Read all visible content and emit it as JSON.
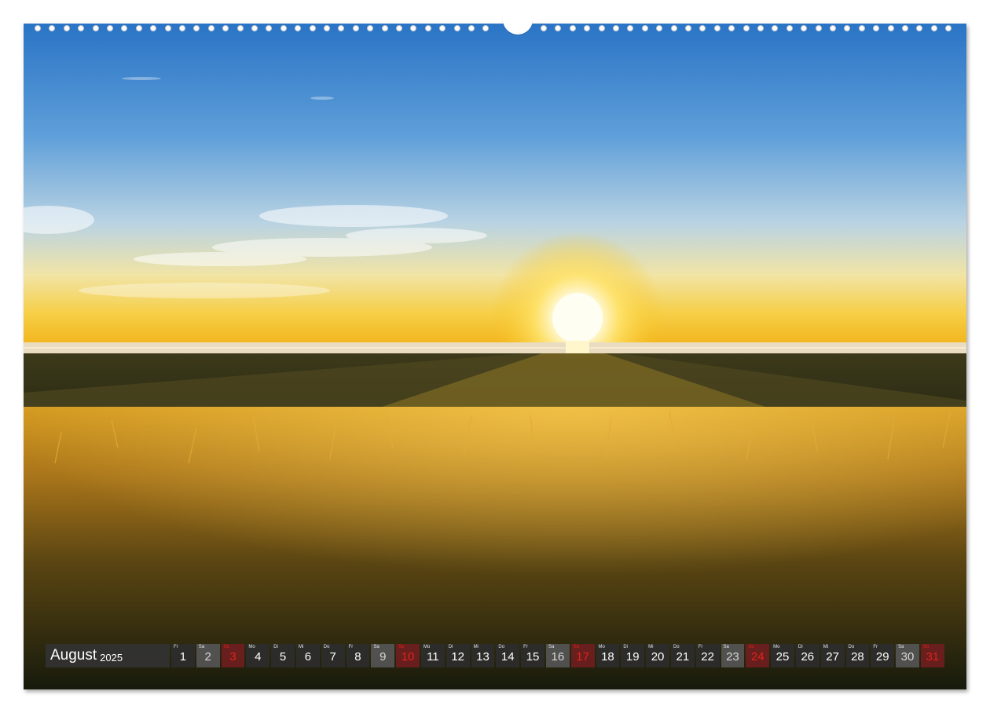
{
  "calendar": {
    "month": "August",
    "year": "2025",
    "days": [
      {
        "num": "1",
        "wd": "Fr",
        "type": "weekday"
      },
      {
        "num": "2",
        "wd": "Sa",
        "type": "sat"
      },
      {
        "num": "3",
        "wd": "So",
        "type": "sun"
      },
      {
        "num": "4",
        "wd": "Mo",
        "type": "weekday"
      },
      {
        "num": "5",
        "wd": "Di",
        "type": "weekday"
      },
      {
        "num": "6",
        "wd": "Mi",
        "type": "weekday"
      },
      {
        "num": "7",
        "wd": "Do",
        "type": "weekday"
      },
      {
        "num": "8",
        "wd": "Fr",
        "type": "weekday"
      },
      {
        "num": "9",
        "wd": "Sa",
        "type": "sat"
      },
      {
        "num": "10",
        "wd": "So",
        "type": "sun"
      },
      {
        "num": "11",
        "wd": "Mo",
        "type": "weekday"
      },
      {
        "num": "12",
        "wd": "Di",
        "type": "weekday"
      },
      {
        "num": "13",
        "wd": "Mi",
        "type": "weekday"
      },
      {
        "num": "14",
        "wd": "Do",
        "type": "weekday"
      },
      {
        "num": "15",
        "wd": "Fr",
        "type": "weekday"
      },
      {
        "num": "16",
        "wd": "Sa",
        "type": "sat"
      },
      {
        "num": "17",
        "wd": "So",
        "type": "sun"
      },
      {
        "num": "18",
        "wd": "Mo",
        "type": "weekday"
      },
      {
        "num": "19",
        "wd": "Di",
        "type": "weekday"
      },
      {
        "num": "20",
        "wd": "Mi",
        "type": "weekday"
      },
      {
        "num": "21",
        "wd": "Do",
        "type": "weekday"
      },
      {
        "num": "22",
        "wd": "Fr",
        "type": "weekday"
      },
      {
        "num": "23",
        "wd": "Sa",
        "type": "sat"
      },
      {
        "num": "24",
        "wd": "So",
        "type": "sun"
      },
      {
        "num": "25",
        "wd": "Mo",
        "type": "weekday"
      },
      {
        "num": "26",
        "wd": "Di",
        "type": "weekday"
      },
      {
        "num": "27",
        "wd": "Mi",
        "type": "weekday"
      },
      {
        "num": "28",
        "wd": "Do",
        "type": "weekday"
      },
      {
        "num": "29",
        "wd": "Fr",
        "type": "weekday"
      },
      {
        "num": "30",
        "wd": "Sa",
        "type": "sat"
      },
      {
        "num": "31",
        "wd": "So",
        "type": "sun"
      }
    ]
  },
  "colors": {
    "sunday_red": "#e0241b",
    "sky_top": "#2e78c8",
    "horizon_gold": "#f7c21c",
    "grass_gold": "#c8961e"
  }
}
